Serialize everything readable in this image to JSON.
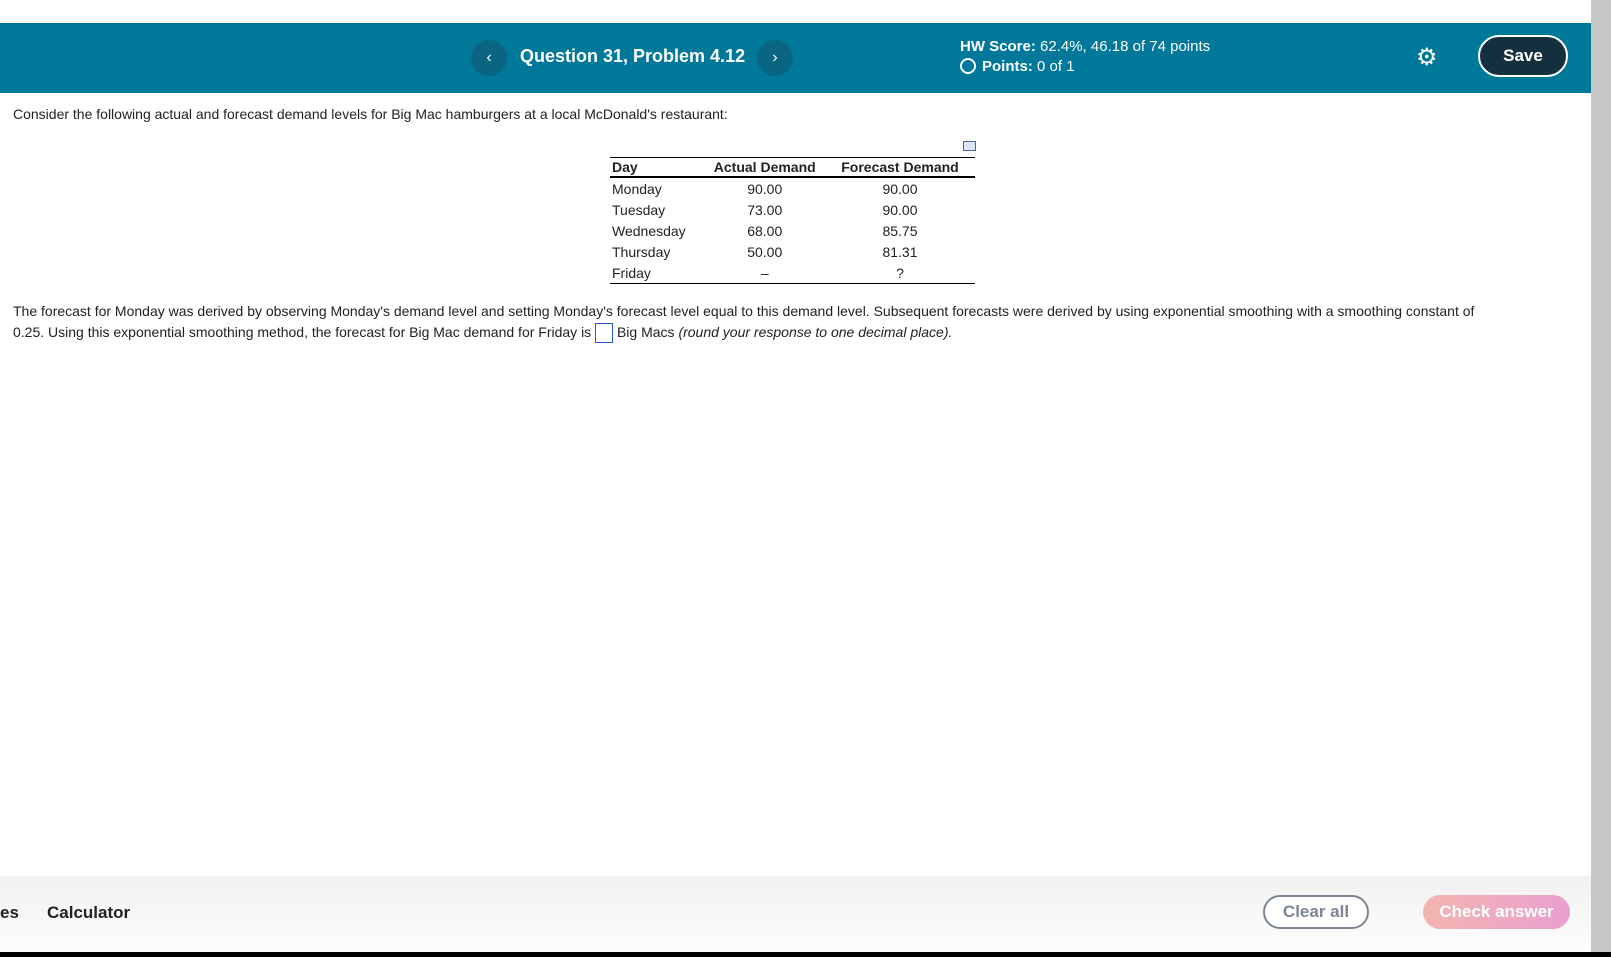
{
  "header": {
    "prev": "‹",
    "next": "›",
    "title": "Question 31, Problem 4.12",
    "hw_score_label": "HW Score:",
    "hw_score_value": "62.4%, 46.18 of 74 points",
    "points_label": "Points:",
    "points_value": "0 of 1",
    "save": "Save",
    "icons": [
      "chevron-left",
      "chevron-right",
      "circle",
      "gear"
    ]
  },
  "question": {
    "intro": "Consider the following actual and forecast demand levels for Big Mac hamburgers at a local McDonald's restaurant:",
    "table": {
      "headers": [
        "Day",
        "Actual Demand",
        "Forecast Demand"
      ],
      "rows": [
        [
          "Monday",
          "90.00",
          "90.00"
        ],
        [
          "Tuesday",
          "73.00",
          "90.00"
        ],
        [
          "Wednesday",
          "68.00",
          "85.75"
        ],
        [
          "Thursday",
          "50.00",
          "81.31"
        ],
        [
          "Friday",
          "–",
          "?"
        ]
      ]
    },
    "body1": "The forecast for Monday was derived by observing Monday's demand level and setting Monday's forecast level equal to this demand level.  Subsequent forecasts were derived by using exponential smoothing with a smoothing constant of",
    "body2a": "0.25.  Using this exponential smoothing method, the forecast for Big Mac demand for Friday is",
    "body2b": "Big Macs",
    "body2c": "(round your response to one decimal place)."
  },
  "footer": {
    "partial": "es",
    "calculator": "Calculator",
    "clear": "Clear all",
    "check": "Check answer"
  }
}
